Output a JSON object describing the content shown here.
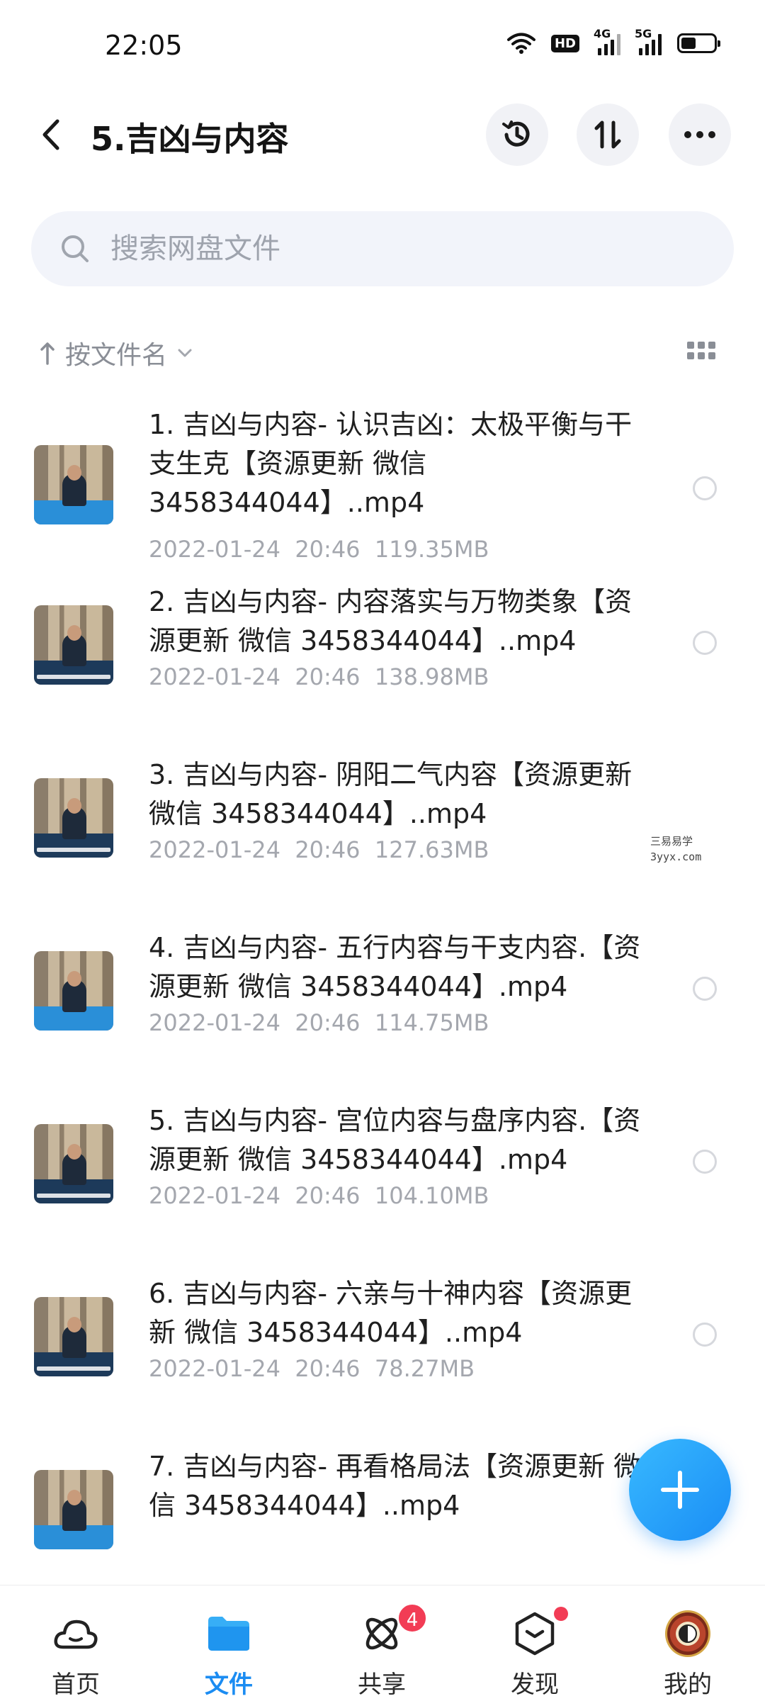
{
  "status_bar": {
    "time": "22:05",
    "hd_badge": "HD",
    "signal_1": "4G",
    "signal_2": "5G"
  },
  "header": {
    "title": "5.吉凶与内容"
  },
  "search": {
    "placeholder": "搜索网盘文件"
  },
  "sort": {
    "label": "按文件名"
  },
  "files": [
    {
      "name": "1. 吉凶与内容- 认识吉凶：太极平衡与干支生克【资源更新 微信 3458344044】..mp4",
      "date": "2022-01-24  20:46",
      "size": "119.35MB"
    },
    {
      "name": "2. 吉凶与内容- 内容落实与万物类象【资源更新 微信 3458344044】..mp4",
      "date": "2022-01-24  20:46",
      "size": "138.98MB"
    },
    {
      "name": "3. 吉凶与内容- 阴阳二气内容【资源更新 微信 3458344044】..mp4",
      "date": "2022-01-24  20:46",
      "size": "127.63MB"
    },
    {
      "name": "4. 吉凶与内容- 五行内容与干支内容.【资源更新 微信 3458344044】.mp4",
      "date": "2022-01-24  20:46",
      "size": "114.75MB"
    },
    {
      "name": "5. 吉凶与内容- 宫位内容与盘序内容.【资源更新 微信 3458344044】.mp4",
      "date": "2022-01-24  20:46",
      "size": "104.10MB"
    },
    {
      "name": "6. 吉凶与内容- 六亲与十神内容【资源更新 微信 3458344044】..mp4",
      "date": "2022-01-24  20:46",
      "size": "78.27MB"
    },
    {
      "name": "7. 吉凶与内容- 再看格局法【资源更新 微信 3458344044】..mp4",
      "date": "2022-01-24  20:46",
      "size": ""
    }
  ],
  "watermark": {
    "line1": "三易易学",
    "line2": "3yyx.com"
  },
  "nav": {
    "items": [
      {
        "label": "首页"
      },
      {
        "label": "文件"
      },
      {
        "label": "共享",
        "badge": "4"
      },
      {
        "label": "发现"
      },
      {
        "label": "我的"
      }
    ]
  },
  "colors": {
    "accent": "#1b8cf2",
    "badge": "#f23c55",
    "meta": "#a4a7ae"
  }
}
